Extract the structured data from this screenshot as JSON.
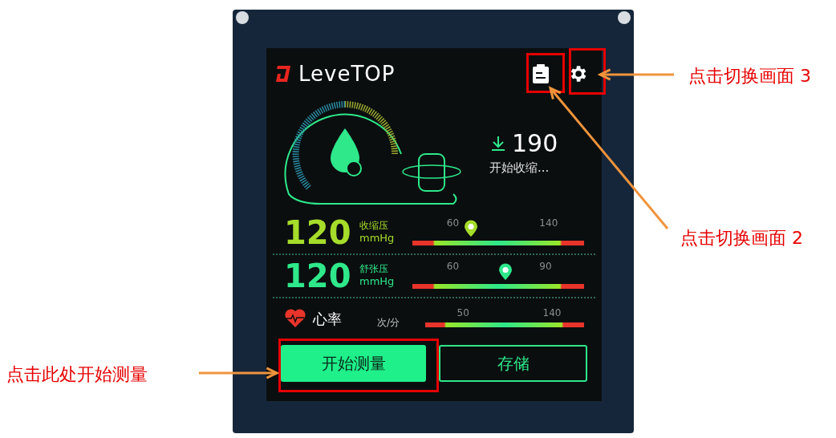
{
  "annotations": [
    {
      "text": "点击切换画面 3"
    },
    {
      "text": "点击切换画面 2"
    },
    {
      "text": "点击此处开始测量"
    }
  ],
  "screen": {
    "logo": "LeveTOP",
    "gauge": {
      "reading": "190",
      "status": "开始收缩..."
    },
    "readings": [
      {
        "value": "120",
        "label": "收缩压",
        "unit": "mmHg",
        "ticks": [
          "60",
          "140"
        ],
        "level": 0.34,
        "color": "#a6dc2a"
      },
      {
        "value": "120",
        "label": "舒张压",
        "unit": "mmHg",
        "ticks": [
          "60",
          "90"
        ],
        "level": 0.54,
        "color": "#2ee88a"
      }
    ],
    "heart_rate": {
      "label": "心率",
      "unit": "次/分",
      "ticks": [
        "50",
        "140"
      ]
    },
    "buttons": [
      {
        "label": "开始测量",
        "selected": true
      },
      {
        "label": "存储",
        "selected": false
      }
    ]
  }
}
